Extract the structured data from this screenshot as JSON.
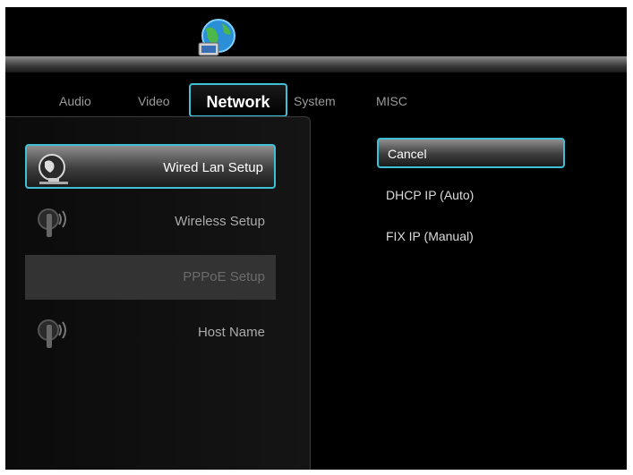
{
  "tabs": [
    "Audio",
    "Video",
    "Network",
    "System",
    "MISC"
  ],
  "active_tab": "Network",
  "menu": {
    "items": [
      {
        "label": "Wired Lan Setup",
        "icon": "wired-lan-icon",
        "state": "selected"
      },
      {
        "label": "Wireless Setup",
        "icon": "wireless-icon",
        "state": "normal"
      },
      {
        "label": "PPPoE Setup",
        "icon": "",
        "state": "disabled"
      },
      {
        "label": "Host Name",
        "icon": "wireless-icon",
        "state": "normal"
      }
    ]
  },
  "options": [
    {
      "label": "Cancel",
      "state": "selected"
    },
    {
      "label": "DHCP IP (Auto)",
      "state": "normal"
    },
    {
      "label": "FIX IP (Manual)",
      "state": "normal"
    }
  ],
  "colors": {
    "accent": "#3fc0d6",
    "background": "#000000"
  }
}
